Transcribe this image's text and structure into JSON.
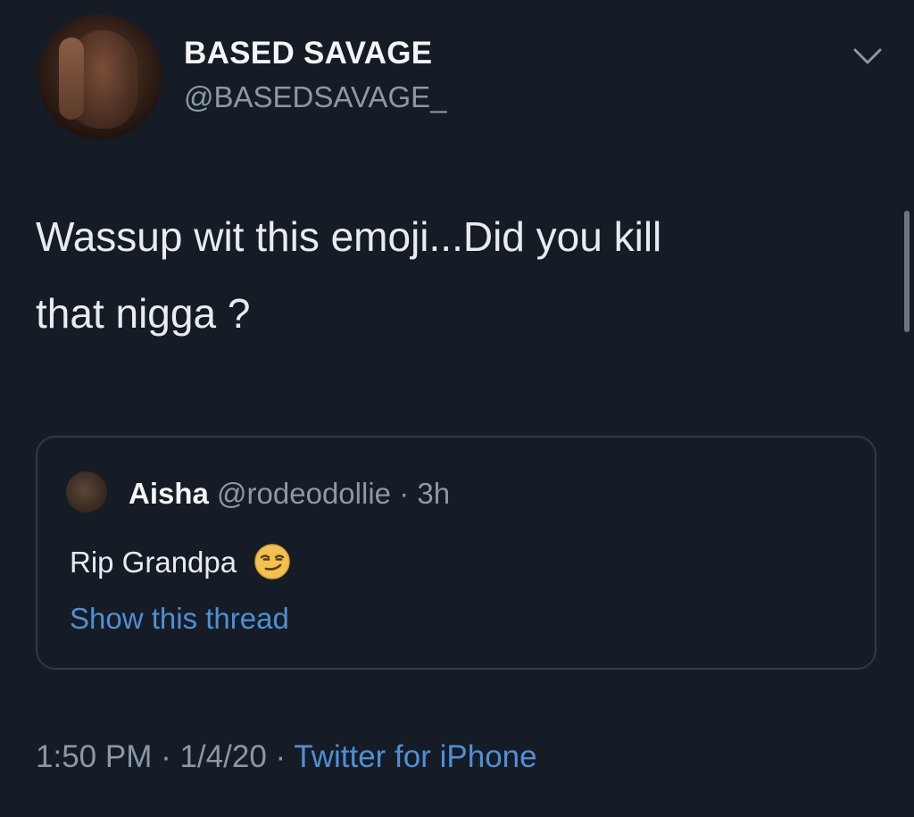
{
  "author": {
    "display_name": "BASED SAVAGE",
    "handle": "@BASEDSAVAGE_"
  },
  "tweet": {
    "text_line1": "Wassup wit this emoji...Did you kill",
    "text_line2": "that nigga ?"
  },
  "quoted_tweet": {
    "name": "Aisha",
    "handle": "@rodeodollie",
    "separator": "·",
    "age": "3h",
    "text": "Rip Grandpa",
    "emoji_icon": "smirking-face-emoji",
    "show_thread_label": "Show this thread"
  },
  "meta": {
    "time": "1:50 PM",
    "separator1": " · ",
    "date": "1/4/20",
    "separator2": " · ",
    "source": "Twitter for iPhone"
  },
  "colors": {
    "background": "#151c26",
    "link": "#4f8fd4",
    "secondary_text": "#8b98a5"
  }
}
